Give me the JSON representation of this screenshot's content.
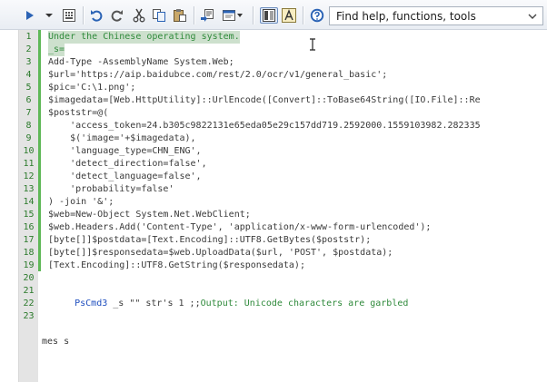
{
  "toolbar": {
    "icons": [
      "run-icon",
      "run-dropdown-icon",
      "record-icon",
      "undo-icon",
      "redo-icon",
      "cut-icon",
      "copy-icon",
      "paste-icon",
      "find-replace-icon",
      "window-dropdown-icon",
      "panel-toggle-icon",
      "text-mode-icon",
      "help-icon"
    ],
    "search": {
      "placeholder": "Find help, functions, tools",
      "value": ""
    }
  },
  "editor": {
    "lines": [
      {
        "num": "1",
        "text": "Under the Chinese operating system."
      },
      {
        "num": "2",
        "text": "_s="
      },
      {
        "num": "3",
        "text": "Add-Type -AssemblyName System.Web;"
      },
      {
        "num": "4",
        "text": "$url='https://aip.baidubce.com/rest/2.0/ocr/v1/general_basic';"
      },
      {
        "num": "5",
        "text": "$pic='C:\\1.png';"
      },
      {
        "num": "6",
        "text": "$imagedata=[Web.HttpUtility]::UrlEncode([Convert]::ToBase64String([IO.File]::Re"
      },
      {
        "num": "7",
        "text": "$poststr=@("
      },
      {
        "num": "8",
        "text": "    'access_token=24.b305c9822131e65eda05e29c157dd719.2592000.1559103982.282335"
      },
      {
        "num": "9",
        "text": "    $('image='+$imagedata),"
      },
      {
        "num": "10",
        "text": "    'language_type=CHN_ENG',"
      },
      {
        "num": "11",
        "text": "    'detect_direction=false',"
      },
      {
        "num": "12",
        "text": "    'detect_language=false',"
      },
      {
        "num": "13",
        "text": "    'probability=false'"
      },
      {
        "num": "14",
        "text": ") -join '&';"
      },
      {
        "num": "15",
        "text": "$web=New-Object System.Net.WebClient;"
      },
      {
        "num": "16",
        "text": "$web.Headers.Add('Content-Type', 'application/x-www-form-urlencoded');"
      },
      {
        "num": "17",
        "text": "[byte[]]$postdata=[Text.Encoding]::UTF8.GetBytes($poststr);"
      },
      {
        "num": "18",
        "text": "[byte[]]$responsedata=$web.UploadData($url, 'POST', $postdata);"
      },
      {
        "num": "19",
        "text": "[Text.Encoding]::UTF8.GetString($responsedata);"
      },
      {
        "num": "20",
        "text": ""
      },
      {
        "num": "21",
        "name": "PsCmd3",
        "rest": " _s \"\" str's 1 ;;",
        "comment": "Output: Unicode characters are garbled"
      },
      {
        "num": "22",
        "text": ""
      },
      {
        "num": "23",
        "text": ""
      },
      {
        "num": "",
        "text": "mes s"
      }
    ]
  }
}
